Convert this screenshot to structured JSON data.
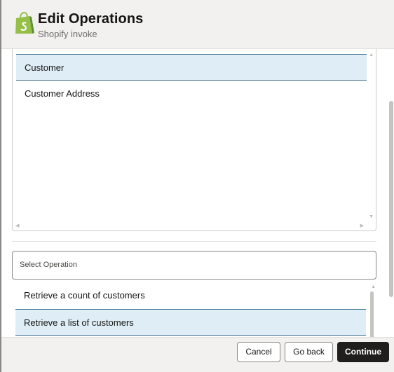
{
  "header": {
    "title": "Edit Operations",
    "subtitle": "Shopify invoke",
    "logo_icon": "shopify-bag-icon",
    "accent_color": "#95bf47"
  },
  "entities": {
    "items": [
      {
        "label": "Customer",
        "selected": true
      },
      {
        "label": "Customer Address",
        "selected": false
      }
    ]
  },
  "operation_select": {
    "placeholder": "Select Operation"
  },
  "operations": {
    "items": [
      {
        "label": "Retrieve a count of customers",
        "selected": false
      },
      {
        "label": "Retrieve a list of customers",
        "selected": true
      }
    ]
  },
  "footer": {
    "cancel_label": "Cancel",
    "go_back_label": "Go back",
    "continue_label": "Continue"
  }
}
